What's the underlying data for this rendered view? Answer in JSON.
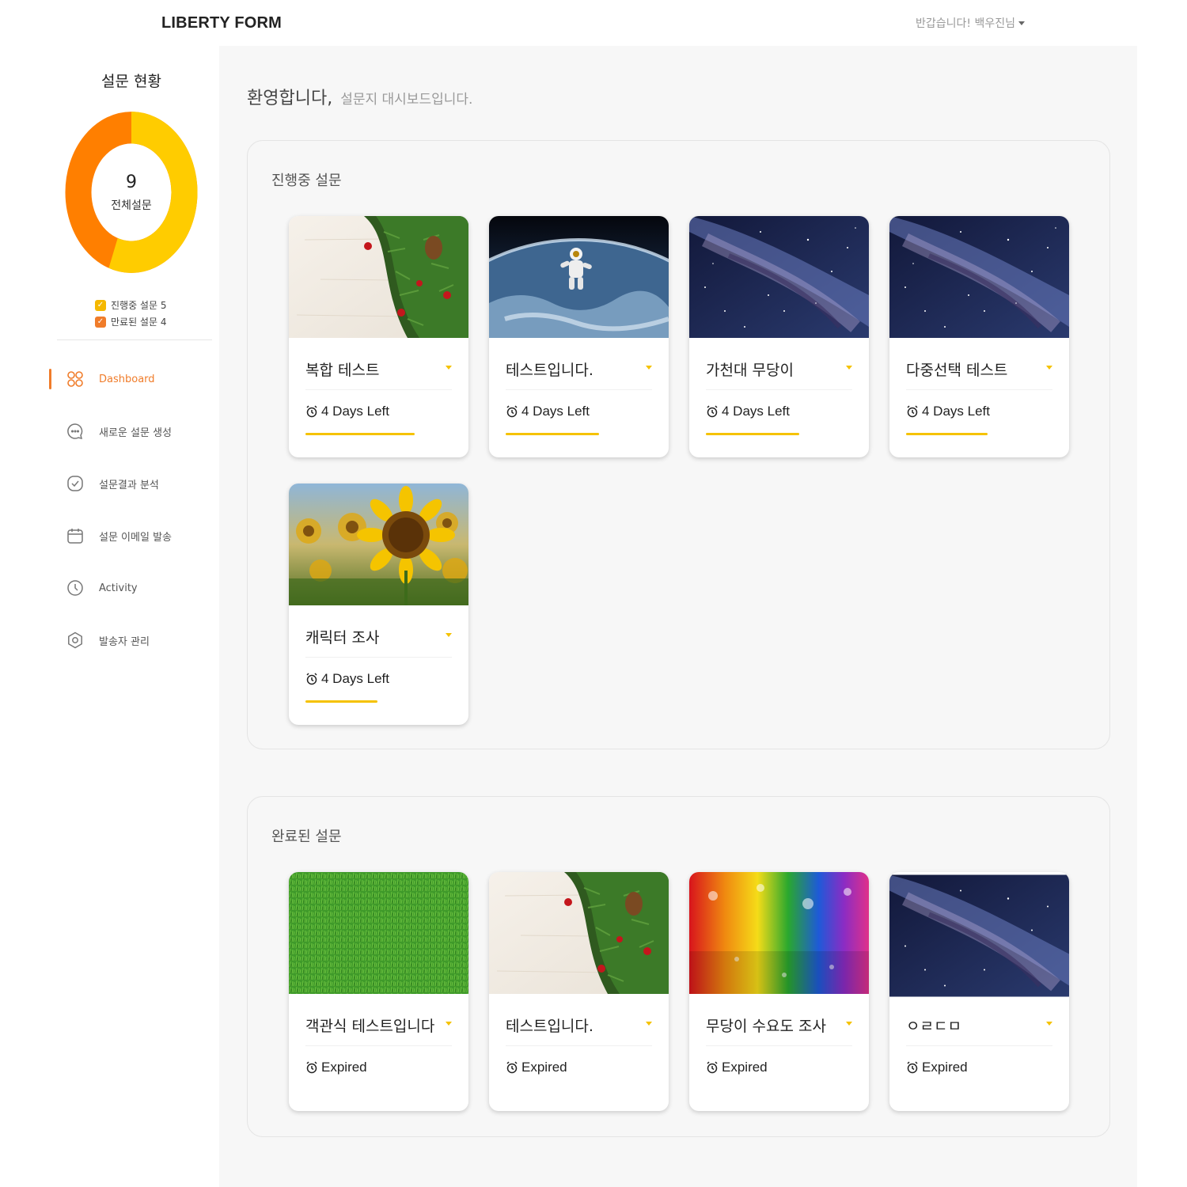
{
  "header": {
    "brand": "LIBERTY FORM",
    "user_greeting": "반갑습니다! 백우진님"
  },
  "sidebar": {
    "status_title": "설문 현황",
    "donut": {
      "total": "9",
      "total_label": "전체설문",
      "ongoing_value": 5,
      "completed_value": 4,
      "ongoing_color": "#ffcc00",
      "completed_color": "#ff7f00"
    },
    "legend": [
      {
        "label": "진행중 설문 5",
        "color": "#f5b800"
      },
      {
        "label": "만료된 설문 4",
        "color": "#f07c2a"
      }
    ],
    "nav": [
      {
        "label": "Dashboard",
        "icon": "dashboard-icon",
        "active": true
      },
      {
        "label": "새로운 설문 생성",
        "icon": "chat-icon",
        "active": false
      },
      {
        "label": "설문결과 분석",
        "icon": "check-icon",
        "active": false
      },
      {
        "label": "설문 이메일 발송",
        "icon": "calendar-icon",
        "active": false
      },
      {
        "label": "Activity",
        "icon": "clock-icon",
        "active": false
      },
      {
        "label": "발송자 관리",
        "icon": "settings-icon",
        "active": false
      }
    ]
  },
  "main": {
    "welcome": "환영합니다,",
    "welcome_sub": "설문지 대시보드입니다.",
    "ongoing": {
      "title": "진행중 설문",
      "cards": [
        {
          "title": "복합 테스트",
          "meta": "4 Days Left",
          "image": "pine-branch-on-wood"
        },
        {
          "title": "테스트입니다.",
          "meta": "4 Days Left",
          "image": "astronaut-over-earth"
        },
        {
          "title": "가천대 무당이",
          "meta": "4 Days Left",
          "image": "milky-way"
        },
        {
          "title": "다중선택 테스트",
          "meta": "4 Days Left",
          "image": "milky-way"
        },
        {
          "title": "캐릭터 조사",
          "meta": "4 Days Left",
          "image": "sunflower-field"
        }
      ]
    },
    "completed": {
      "title": "완료된 설문",
      "cards": [
        {
          "title": "객관식 테스트입니다",
          "meta": "Expired",
          "image": "grass"
        },
        {
          "title": "테스트입니다.",
          "meta": "Expired",
          "image": "pine-branch-on-wood"
        },
        {
          "title": "무당이 수요도 조사",
          "meta": "Expired",
          "image": "rainbow-glitter"
        },
        {
          "title": "ㅇㄹㄷㅁ",
          "meta": "Expired",
          "image": "milky-way"
        }
      ]
    }
  }
}
